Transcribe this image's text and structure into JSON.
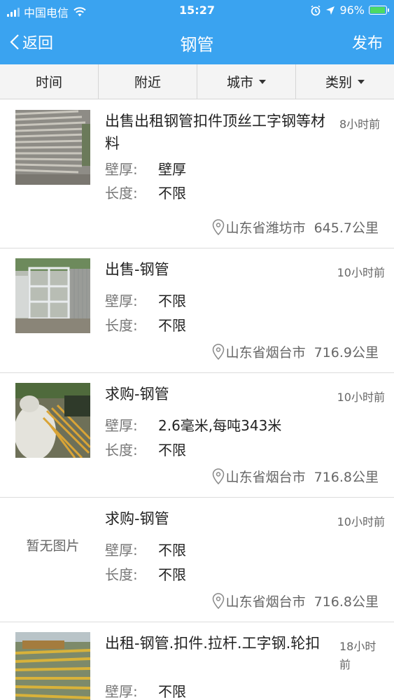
{
  "status": {
    "carrier": "中国电信",
    "time": "15:27",
    "battery": "96%",
    "battery_level": 0.96
  },
  "nav": {
    "back_label": "返回",
    "title": "钢管",
    "publish_label": "发布"
  },
  "filters": [
    {
      "label": "时间",
      "dropdown": false
    },
    {
      "label": "附近",
      "dropdown": false
    },
    {
      "label": "城市",
      "dropdown": true
    },
    {
      "label": "类别",
      "dropdown": true
    }
  ],
  "listings": [
    {
      "title": "出售出租钢管扣件顶丝工字钢等材料",
      "time": "8小时前",
      "thickness_label": "壁厚:",
      "thickness": "壁厚",
      "length_label": "长度:",
      "length": "不限",
      "location": "山东省潍坊市",
      "distance": "645.7公里",
      "image": "steel-pipes-stack"
    },
    {
      "title": "出售-钢管",
      "time": "10小时前",
      "thickness_label": "壁厚:",
      "thickness": "不限",
      "length_label": "长度:",
      "length": "不限",
      "location": "山东省烟台市",
      "distance": "716.9公里",
      "image": "scaffold-frames"
    },
    {
      "title": "求购-钢管",
      "time": "10小时前",
      "thickness_label": "壁厚:",
      "thickness": "2.6毫米,每吨343米",
      "length_label": "长度:",
      "length": "不限",
      "location": "山东省烟台市",
      "distance": "716.8公里",
      "image": "yard-pipes-bags"
    },
    {
      "title": "求购-钢管",
      "time": "10小时前",
      "thickness_label": "壁厚:",
      "thickness": "不限",
      "length_label": "长度:",
      "length": "不限",
      "location": "山东省烟台市",
      "distance": "716.8公里",
      "image": "none",
      "no_image_text": "暂无图片"
    },
    {
      "title": "出租-钢管.扣件.拉杆.工字钢.轮扣",
      "time": "18小时前",
      "thickness_label": "壁厚:",
      "thickness": "不限",
      "image": "yellow-steel-yard"
    }
  ],
  "colors": {
    "header": "#3aa3f0",
    "filter_bg": "#f4f4f4",
    "divider": "#dcdcdc"
  }
}
